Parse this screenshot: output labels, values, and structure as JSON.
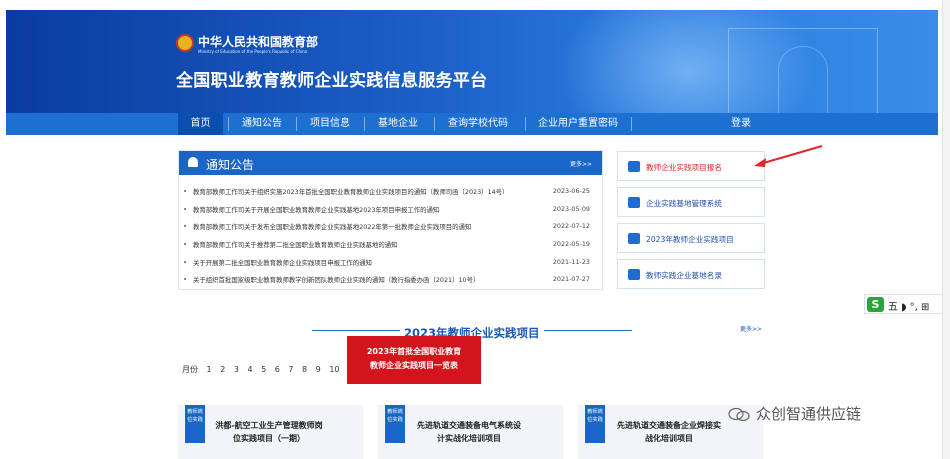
{
  "header": {
    "ministry_cn": "中华人民共和国教育部",
    "ministry_en": "Ministry of Education of the People's Republic of China",
    "site_title": "全国职业教育教师企业实践信息服务平台"
  },
  "nav": {
    "items": [
      {
        "label": "首页",
        "active": true
      },
      {
        "label": "通知公告"
      },
      {
        "label": "项目信息"
      },
      {
        "label": "基地企业"
      },
      {
        "label": "查询学校代码"
      },
      {
        "label": "企业用户重置密码"
      },
      {
        "label": "登录"
      }
    ]
  },
  "notice": {
    "title": "通知公告",
    "more": "更多>>",
    "items": [
      {
        "text": "教育部教师工作司关于组织实施2023年首批全国职业教育教师企业实践项目的通知（教师司函〔2023〕14号）",
        "date": "2023-06-25"
      },
      {
        "text": "教育部教师工作司关于开展全国职业教育教师企业实践基地2023年项目申报工作的通知",
        "date": "2023-05-09"
      },
      {
        "text": "教育部教师工作司关于发布全国职业教育教师企业实践基地2022年第一批教师企业实践项目的通知",
        "date": "2022-07-12"
      },
      {
        "text": "教育部教师工作司关于推荐第二批全国职业教育教师企业实践基地的通知",
        "date": "2022-05-19"
      },
      {
        "text": "关于开展第二批全国职业教育教师企业实践项目申报工作的通知",
        "date": "2021-11-23"
      },
      {
        "text": "关于组织首批国家级职业教育教师教学创新团队教师企业实践的通知（教行指委办函〔2021〕10号）",
        "date": "2021-07-27"
      }
    ]
  },
  "side_links": [
    {
      "label": "教师企业实践项目报名",
      "icon": "form-icon"
    },
    {
      "label": "企业实践基地管理系统",
      "icon": "monitor-icon"
    },
    {
      "label": "2023年教师企业实践项目",
      "icon": "people-icon"
    },
    {
      "label": "教师实践企业基地名录",
      "icon": "mail-icon"
    }
  ],
  "section": {
    "title": "2023年教师企业实践项目",
    "more": "更多>>"
  },
  "popup": {
    "line1": "2023年首批全国职业教育",
    "line2": "教师企业实践项目一览表"
  },
  "months": {
    "label": "月份",
    "values": [
      "1",
      "2",
      "3",
      "4",
      "5",
      "6",
      "7",
      "8",
      "9",
      "10"
    ]
  },
  "cards": [
    {
      "tag": "教师岗位实践",
      "title": "洪都-航空工业生产管理教师岗位实践项目（一期）"
    },
    {
      "tag": "教师岗位实践",
      "title": "先进轨道交通装备电气系统设计实战化培训项目"
    },
    {
      "tag": "教师岗位实践",
      "title": "先进轨道交通装备企业焊接实战化培训项目"
    }
  ],
  "sticker": {
    "icon_letter": "S",
    "text": "五 ◗ °, ⊞"
  },
  "watermark": {
    "text": "众创智通供应链"
  },
  "colors": {
    "primary": "#1d6fd1",
    "dark_blue": "#0a3c9e",
    "red": "#d4141c",
    "arrow": "#e0262a"
  }
}
